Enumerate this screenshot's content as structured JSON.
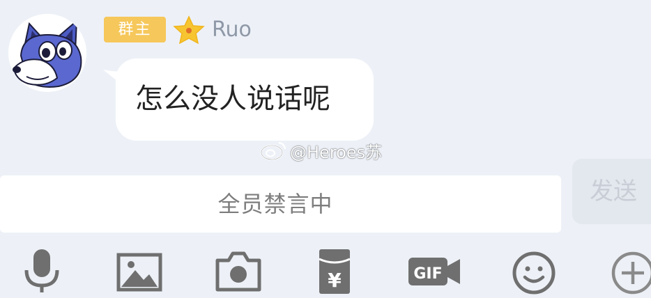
{
  "message": {
    "sender": {
      "role_badge": "群主",
      "name": "Ruo"
    },
    "text": "怎么没人说话呢"
  },
  "watermark": {
    "text": "@Heroes苏"
  },
  "composer": {
    "input_text": "全员禁言中",
    "send_label": "发送"
  },
  "toolbar": {
    "icons": [
      "microphone-icon",
      "image-icon",
      "camera-icon",
      "red-packet-icon",
      "gif-icon",
      "emoji-icon",
      "plus-icon"
    ],
    "red_packet_symbol": "¥",
    "gif_label": "GIF"
  },
  "colors": {
    "background": "#edf1f7",
    "badge": "#f6c75a",
    "star": "#f7c531",
    "icon_gray": "#6f6f6f",
    "send_disabled": "#e3e7ee"
  }
}
